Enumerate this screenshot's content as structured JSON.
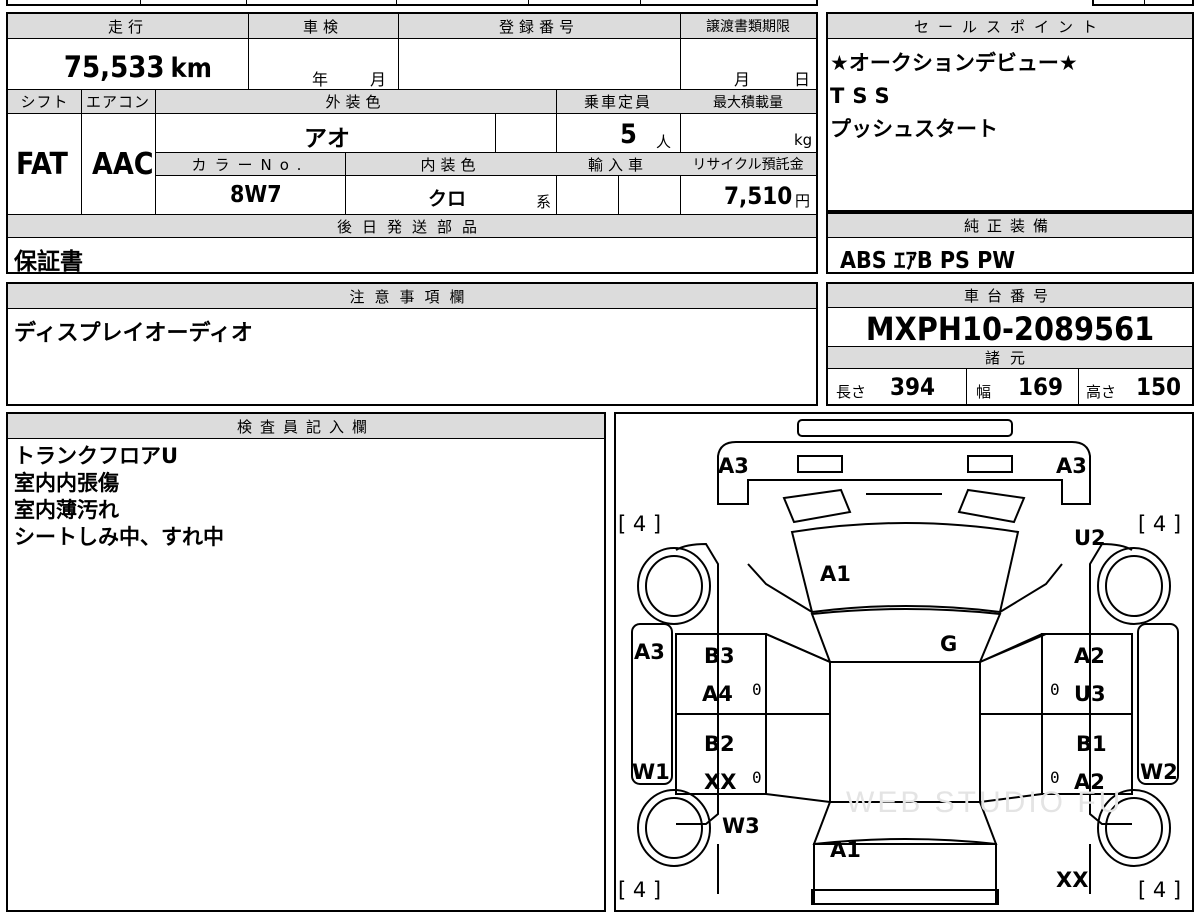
{
  "header_row": {
    "mileage_label": "走行",
    "shaken_label": "車検",
    "registration_label": "登録番号",
    "transfer_deadline_label": "譲渡書類期限",
    "mileage_value": "75,533",
    "mileage_unit": "km",
    "shaken_year": "年",
    "shaken_month": "月",
    "deadline_month": "月",
    "deadline_day": "日"
  },
  "spec_row": {
    "shift_label": "シフト",
    "aircon_label": "エアコン",
    "exterior_color_label": "外装色",
    "capacity_label": "乗車定員",
    "max_load_label": "最大積載量",
    "shift_value": "FAT",
    "aircon_value": "AAC",
    "exterior_color_value": "アオ",
    "capacity_value": "5",
    "capacity_unit": "人",
    "load_unit": "kg",
    "color_no_label": "カラーNo.",
    "interior_color_label": "内装色",
    "import_label": "輸入車",
    "recycle_label": "リサイクル預託金",
    "color_no_value": "8W7",
    "interior_color_value": "クロ",
    "interior_suffix": "系",
    "recycle_value": "7,510",
    "recycle_unit": "円"
  },
  "later_parts": {
    "label": "後日発送部品",
    "value": "保証書"
  },
  "sales_points": {
    "label": "セールスポイント",
    "lines": [
      "★オークションデビュー★",
      "TSS",
      "プッシュスタート"
    ]
  },
  "genuine_equipment": {
    "label": "純正装備",
    "value": "ABS ｴｱB PS PW"
  },
  "notes": {
    "label": "注意事項欄",
    "value": "ディスプレイオーディオ"
  },
  "chassis": {
    "label": "車台番号",
    "value": "MXPH10-2089561",
    "specs_label": "諸元",
    "length_label": "長さ",
    "length_value": "394",
    "width_label": "幅",
    "width_value": "169",
    "height_label": "高さ",
    "height_value": "150"
  },
  "inspector": {
    "label": "検査員記入欄",
    "lines": [
      "トランクフロアU",
      "室内内張傷",
      "室内薄汚れ",
      "シートしみ中、すれ中"
    ]
  },
  "diagram": {
    "tires": [
      "[ 4 ]",
      "[ 4 ]",
      "[ 4 ]",
      "[ 4 ]"
    ],
    "codes": {
      "a3_left": "A3",
      "a3_right": "A3",
      "u2": "U2",
      "a1_front": "A1",
      "g": "G",
      "a3_side": "A3",
      "b3": "B3",
      "a4": "A4",
      "a2_top": "A2",
      "u3": "U3",
      "b2": "B2",
      "xx_left": "XX",
      "b1": "B1",
      "a2_bottom": "A2",
      "w1": "W1",
      "w2": "W2",
      "w3": "W3",
      "a1_rear": "A1",
      "xx_rear": "XX"
    },
    "zeros": [
      "0",
      "0",
      "0",
      "0"
    ],
    "watermark": "WEB STUDIO FU"
  }
}
